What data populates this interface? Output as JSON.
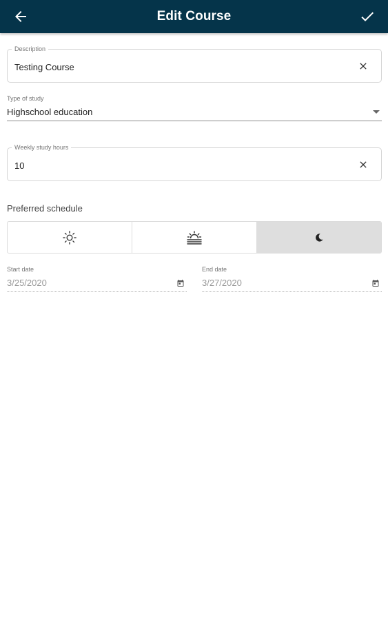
{
  "appbar": {
    "title": "Edit Course",
    "back_icon": "arrow-back-icon",
    "confirm_icon": "check-icon",
    "background_color": "#05344a"
  },
  "form": {
    "description": {
      "label": "Description",
      "value": "Testing Course"
    },
    "type_of_study": {
      "label": "Type of study",
      "value": "Highschool education"
    },
    "weekly_hours": {
      "label": "Weekly study hours",
      "value": "10"
    },
    "schedule": {
      "label": "Preferred schedule",
      "options": [
        {
          "icon": "sun-icon",
          "selected": false
        },
        {
          "icon": "sunset-icon",
          "selected": false
        },
        {
          "icon": "moon-icon",
          "selected": true
        }
      ]
    },
    "start_date": {
      "label": "Start date",
      "value": "3/25/2020"
    },
    "end_date": {
      "label": "End date",
      "value": "3/27/2020"
    }
  }
}
